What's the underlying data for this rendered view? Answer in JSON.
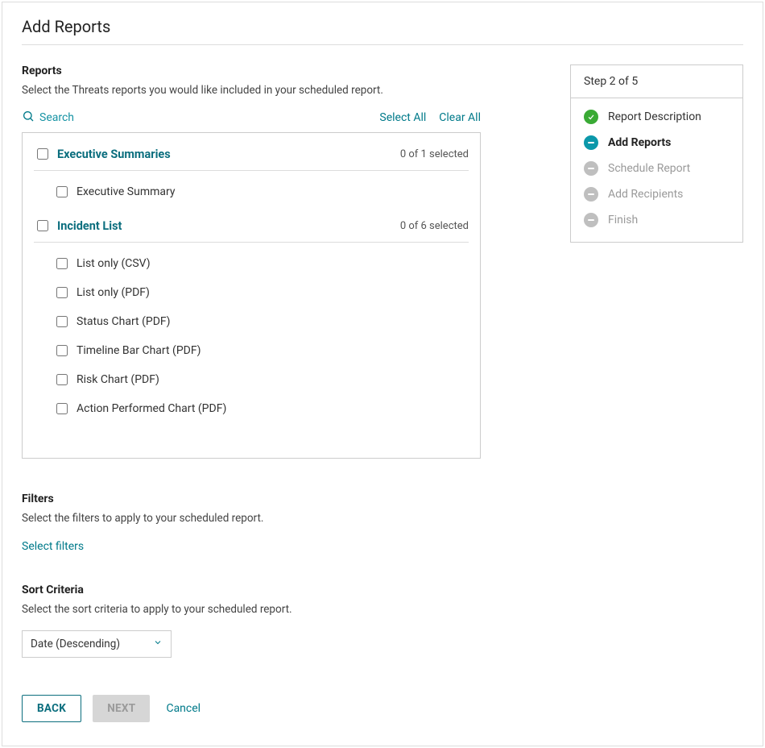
{
  "page": {
    "title": "Add Reports"
  },
  "reports": {
    "title": "Reports",
    "description": "Select the Threats reports you would like included in your scheduled report.",
    "search_label": "Search",
    "select_all": "Select All",
    "clear_all": "Clear All",
    "groups": [
      {
        "name": "Executive Summaries",
        "count": "0 of 1 selected",
        "items": [
          "Executive Summary"
        ]
      },
      {
        "name": "Incident List",
        "count": "0 of 6 selected",
        "items": [
          "List only (CSV)",
          "List only (PDF)",
          "Status Chart (PDF)",
          "Timeline Bar Chart (PDF)",
          "Risk Chart (PDF)",
          "Action Performed Chart (PDF)"
        ]
      }
    ]
  },
  "filters": {
    "title": "Filters",
    "description": "Select the filters to apply to your scheduled report.",
    "link": "Select filters"
  },
  "sort": {
    "title": "Sort Criteria",
    "description": "Select the sort criteria to apply to your scheduled report.",
    "selected": "Date (Descending)"
  },
  "footer": {
    "back": "BACK",
    "next": "NEXT",
    "cancel": "Cancel"
  },
  "stepper": {
    "header": "Step 2 of 5",
    "steps": [
      {
        "label": "Report Description",
        "state": "done"
      },
      {
        "label": "Add Reports",
        "state": "current"
      },
      {
        "label": "Schedule Report",
        "state": "pending"
      },
      {
        "label": "Add Recipients",
        "state": "pending"
      },
      {
        "label": "Finish",
        "state": "pending"
      }
    ]
  }
}
